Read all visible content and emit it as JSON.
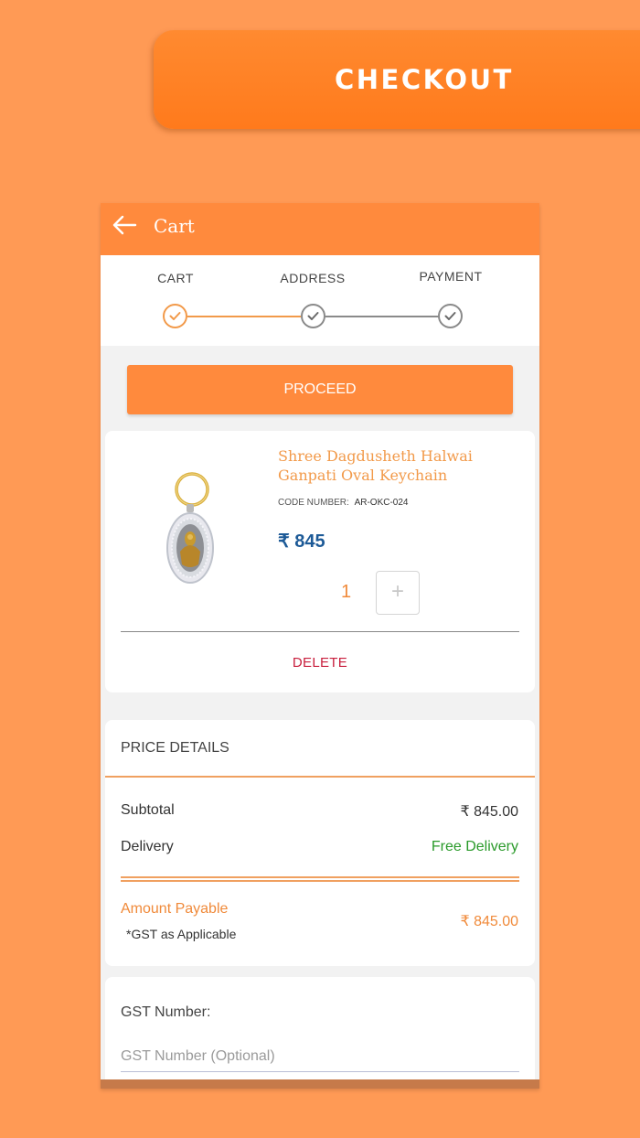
{
  "banner": {
    "title": "CHECKOUT"
  },
  "appbar": {
    "title": "Cart"
  },
  "stepper": {
    "steps": [
      {
        "label": "CART"
      },
      {
        "label": "ADDRESS"
      },
      {
        "label": "PAYMENT"
      }
    ],
    "active_color": "#f29a4a",
    "inactive_color": "#8a8a8a"
  },
  "actions": {
    "proceed_label": "PROCEED",
    "delete_label": "DELETE"
  },
  "product": {
    "title": "Shree Dagdusheth Halwai Ganpati Oval Keychain",
    "code_label": "CODE NUMBER:",
    "code_value": "AR-OKC-024",
    "price": "₹ 845",
    "quantity": "1",
    "plus_symbol": "+"
  },
  "price_details": {
    "title": "PRICE DETAILS",
    "subtotal_label": "Subtotal",
    "subtotal_value": "₹ 845.00",
    "delivery_label": "Delivery",
    "delivery_value": "Free Delivery",
    "amount_label": "Amount Payable",
    "amount_value": "₹ 845.00",
    "gst_note": "*GST as Applicable"
  },
  "gst": {
    "label": "GST Number:",
    "placeholder": "GST Number (Optional)",
    "value": ""
  },
  "colors": {
    "background": "#ff9a55",
    "accent": "#ff8a3d",
    "price_blue": "#1d5a97",
    "delete_red": "#c81e3c",
    "free_green": "#2a9a2a"
  }
}
